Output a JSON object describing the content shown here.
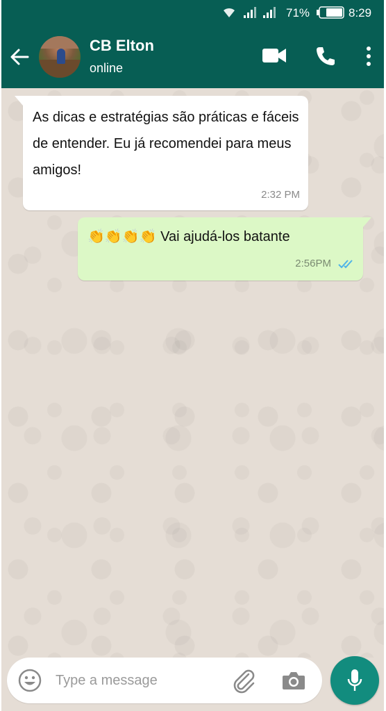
{
  "status_bar": {
    "battery_percent": "71%",
    "time": "8:29"
  },
  "header": {
    "contact_name": "CB Elton",
    "contact_status": "online"
  },
  "messages": [
    {
      "direction": "incoming",
      "text": "As dicas e estratégias são práticas e fáceis de entender. Eu já recomendei para meus amigos!",
      "time": "2:32 PM"
    },
    {
      "direction": "outgoing",
      "text": "👏👏👏👏 Vai ajudá-los batante",
      "time": "2:56PM",
      "status": "read"
    }
  ],
  "composer": {
    "placeholder": "Type a message"
  },
  "colors": {
    "header": "#075e54",
    "outgoing_bubble": "#dcf8c6",
    "incoming_bubble": "#ffffff",
    "mic_button": "#128c7e",
    "chat_background": "#e5ddd5",
    "read_ticks": "#4fb3e8"
  },
  "icons": [
    "wifi-icon",
    "signal-icon",
    "battery-icon",
    "back-arrow-icon",
    "video-call-icon",
    "phone-icon",
    "more-vert-icon",
    "emoji-icon",
    "attach-icon",
    "camera-icon",
    "mic-icon",
    "double-check-icon"
  ]
}
